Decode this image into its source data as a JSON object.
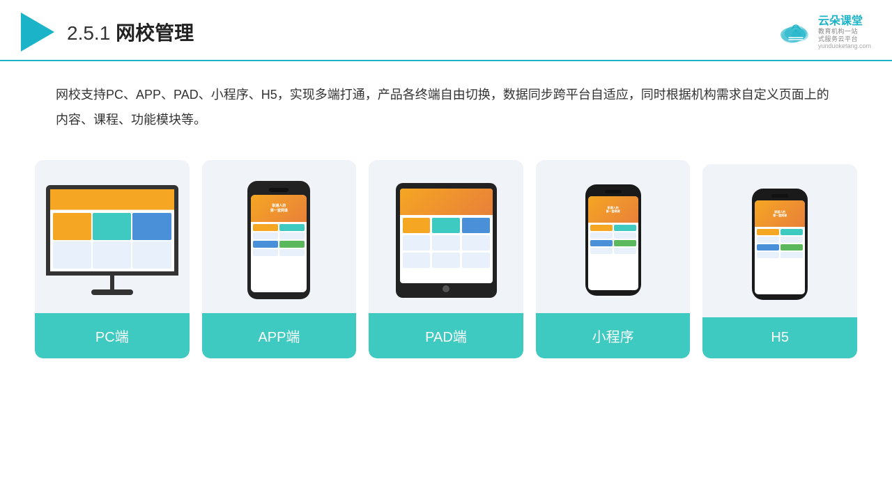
{
  "header": {
    "title_number": "2.5.1",
    "title_chinese": "网校管理",
    "logo_main": "云朵课堂",
    "logo_sub": "教育机构一站\n式服务云平台",
    "logo_domain": "yunduoketang.com"
  },
  "description": {
    "text": "网校支持PC、APP、PAD、小程序、H5，实现多端打通，产品各终端自由切换，数据同步跨平台自适应，同时根据机构需求自定义页面上的内容、课程、功能模块等。"
  },
  "cards": [
    {
      "id": "pc",
      "label": "PC端"
    },
    {
      "id": "app",
      "label": "APP端"
    },
    {
      "id": "pad",
      "label": "PAD端"
    },
    {
      "id": "miniprogram",
      "label": "小程序"
    },
    {
      "id": "h5",
      "label": "H5"
    }
  ]
}
